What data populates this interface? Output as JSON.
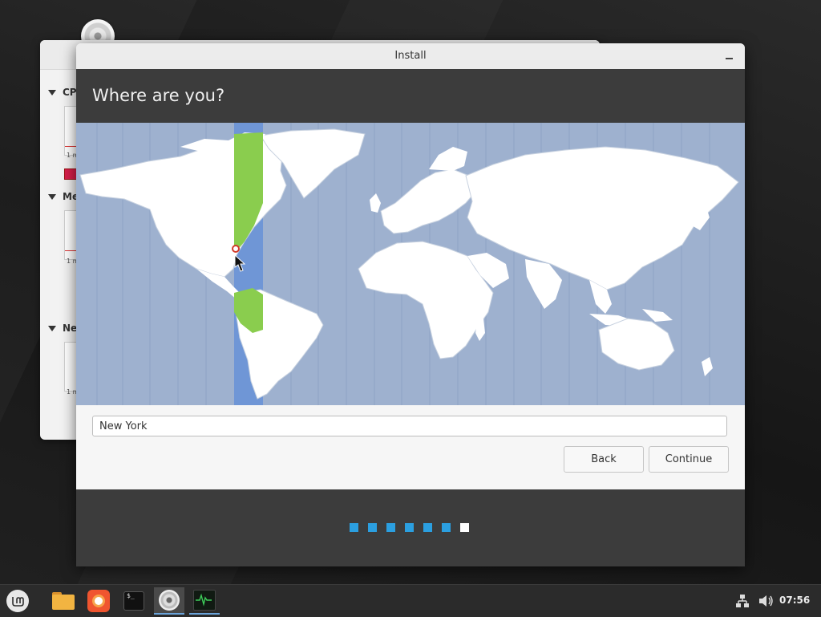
{
  "dialog": {
    "window_title": "Install",
    "heading": "Where are you?",
    "location_value": "New York",
    "back_label": "Back",
    "continue_label": "Continue",
    "progress": {
      "total_steps": 7,
      "current_step": 7
    }
  },
  "background_window": {
    "sections": [
      "CP",
      "Me",
      "Ne"
    ],
    "tick_label": "1 m"
  },
  "taskbar": {
    "items": [
      {
        "name": "menu-button",
        "icon": "linux-mint-icon"
      },
      {
        "name": "files",
        "icon": "folder-icon"
      },
      {
        "name": "firefox",
        "icon": "firefox-icon"
      },
      {
        "name": "terminal",
        "icon": "terminal-icon"
      },
      {
        "name": "installer",
        "icon": "disc-icon"
      },
      {
        "name": "system-monitor",
        "icon": "system-monitor-icon"
      }
    ],
    "tray_icons": [
      "network-icon",
      "volume-icon"
    ],
    "clock": "07:56"
  },
  "colors": {
    "dialog_band": "#3c3c3c",
    "ocean": "#9eb1cf",
    "land": "#ffffff",
    "timezone_highlight": "#6f96d6",
    "timezone_land": "#8acd4e",
    "progress_step": "#2b9fe0",
    "progress_current": "#ffffff"
  }
}
